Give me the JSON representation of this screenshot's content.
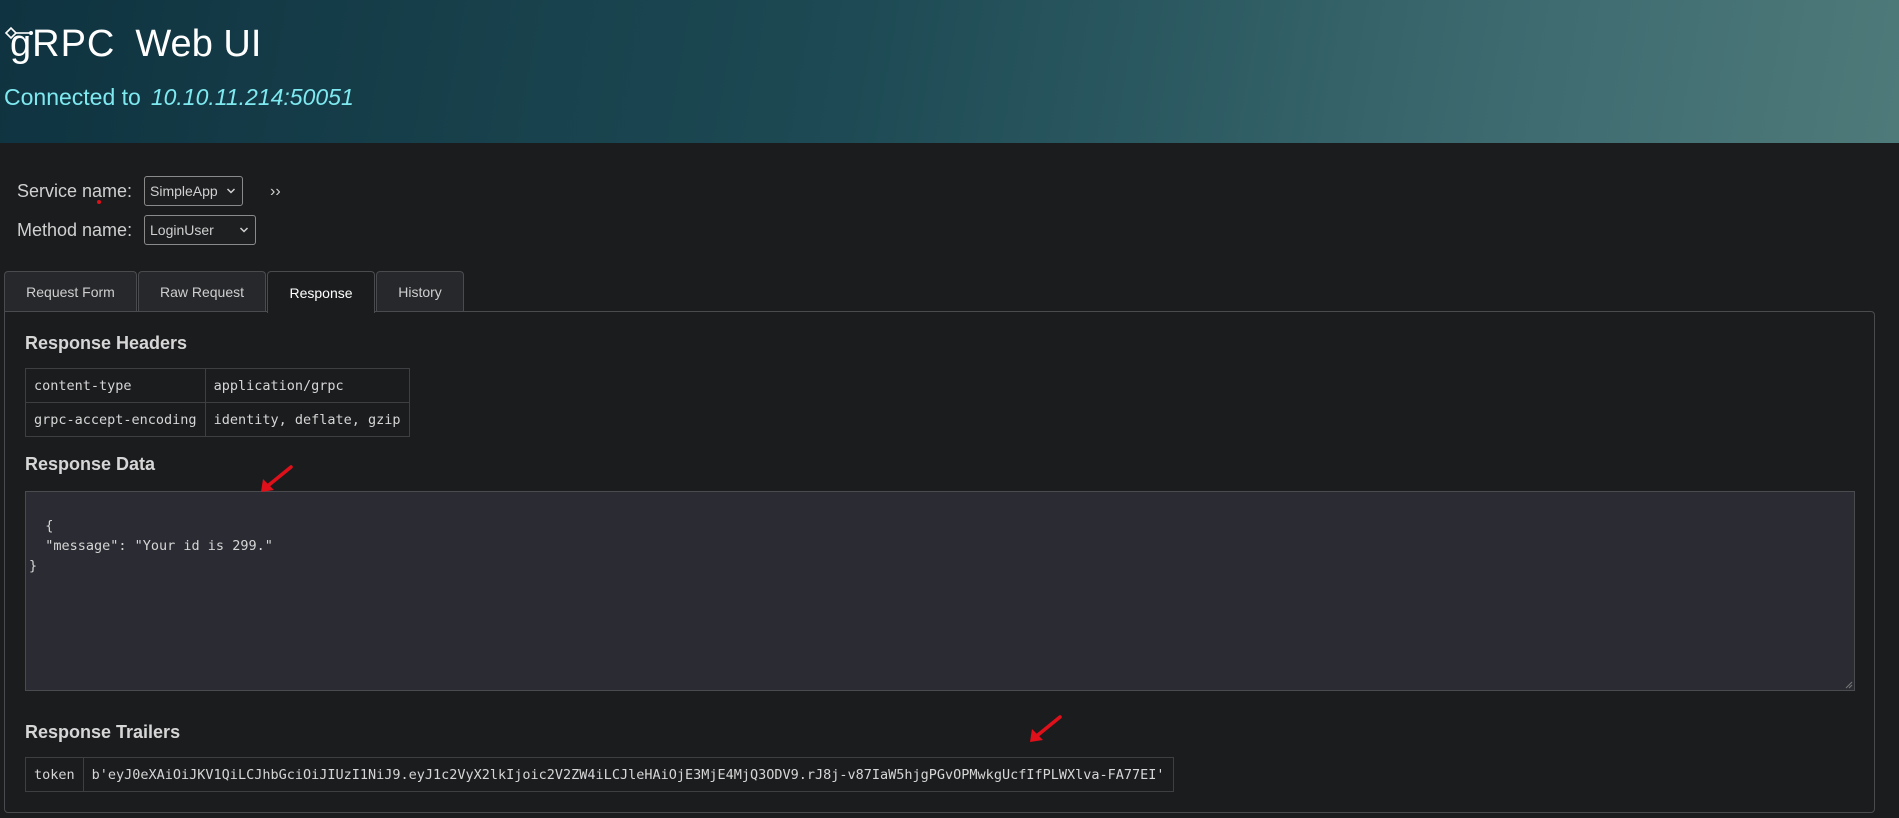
{
  "header": {
    "logo_text": "gRPC",
    "title": "Web UI",
    "connected_label": "Connected to",
    "address": "10.10.11.214:50051"
  },
  "service": {
    "label": "Service name:",
    "selected": "SimpleApp"
  },
  "method": {
    "label": "Method name:",
    "selected": "LoginUser"
  },
  "expand_label": "››",
  "tabs": [
    {
      "label": "Request Form",
      "active": false
    },
    {
      "label": "Raw Request",
      "active": false
    },
    {
      "label": "Response",
      "active": true
    },
    {
      "label": "History",
      "active": false
    }
  ],
  "response": {
    "headers_title": "Response Headers",
    "headers": [
      {
        "key": "content-type",
        "value": "application/grpc"
      },
      {
        "key": "grpc-accept-encoding",
        "value": "identity, deflate, gzip"
      }
    ],
    "data_title": "Response Data",
    "data_text": "{\n  \"message\": \"Your id is 299.\"\n}",
    "trailers_title": "Response Trailers",
    "trailers": [
      {
        "key": "token",
        "value": "b'eyJ0eXAiOiJKV1QiLCJhbGciOiJIUzI1NiJ9.eyJ1c2VyX2lkIjoic2V2ZW4iLCJleHAiOjE3MjE4MjQ3ODV9.rJ8j-v87IaW5hjgPGvOPMwkgUcfIfPLWXlva-FA77EI'"
      }
    ]
  },
  "colors": {
    "annotation_arrow": "#e0101a",
    "address": "#7fe9f0"
  }
}
